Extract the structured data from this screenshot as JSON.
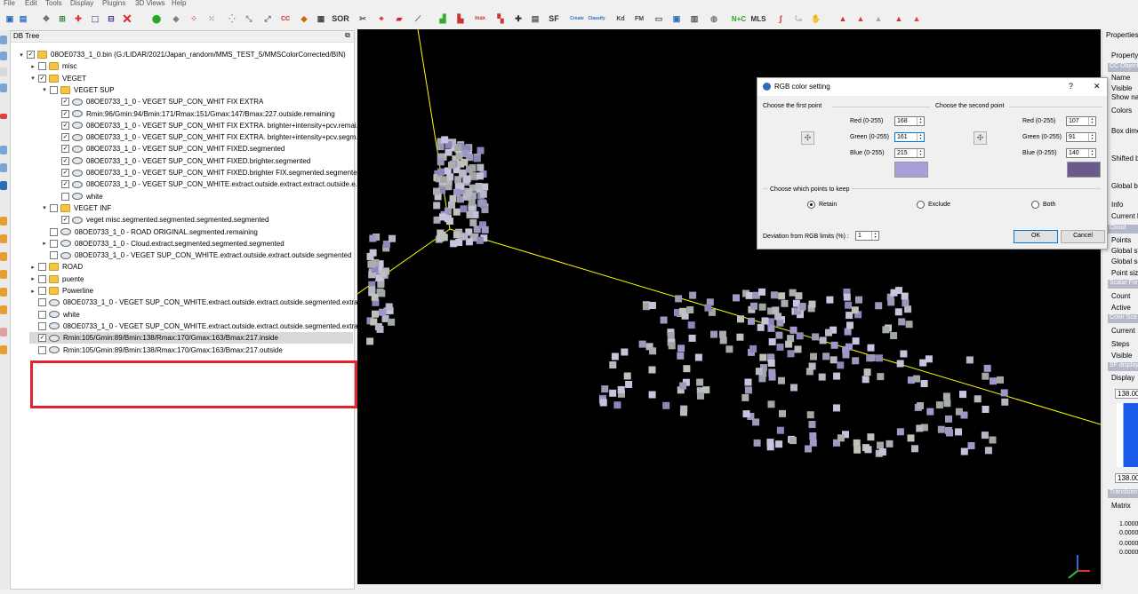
{
  "menu": [
    "File",
    "Edit",
    "Tools",
    "Display",
    "Plugins",
    "3D Views",
    "Help"
  ],
  "toolbar": {
    "sor_label": "SOR",
    "sf_label": "SF",
    "kd_label": "Kd",
    "fm_label": "FM",
    "nc_label": "N+C",
    "mls_label": "MLS",
    "cc_label": "CC",
    "canupo_create": "Create",
    "canupo_classify": "Classify",
    "max_label": "max"
  },
  "dbtree": {
    "title": "DB Tree",
    "items": [
      {
        "label": "08OE0733_1_0.bin (G:/LIDAR/2021/Japan_random/MMS_TEST_5/MMSColorCorrected/BIN)",
        "type": "folder",
        "checked": true,
        "expanded": true
      },
      {
        "label": "misc",
        "type": "folder",
        "checked": false,
        "expanded": false
      },
      {
        "label": "VEGET",
        "type": "folder",
        "checked": true,
        "expanded": true
      },
      {
        "label": "VEGET SUP",
        "type": "folder",
        "checked": false,
        "expanded": true
      },
      {
        "label": "08OE0733_1_0 - VEGET SUP_CON_WHIT FIX EXTRA",
        "type": "cloud",
        "checked": true
      },
      {
        "label": "Rmin:96/Gmin:94/Bmin:171/Rmax:151/Gmax:147/Bmax:227.outside.remaining",
        "type": "cloud",
        "checked": true
      },
      {
        "label": "08OE0733_1_0 - VEGET SUP_CON_WHIT FIX EXTRA. brighter+intensity+pcv.remai...",
        "type": "cloud",
        "checked": true
      },
      {
        "label": "08OE0733_1_0 - VEGET SUP_CON_WHIT FIX EXTRA. brighter+intensity+pcv.segm...",
        "type": "cloud",
        "checked": true
      },
      {
        "label": "08OE0733_1_0 - VEGET SUP_CON_WHIT FIXED.segmented",
        "type": "cloud",
        "checked": true
      },
      {
        "label": "08OE0733_1_0 - VEGET SUP_CON_WHIT FIXED.brighter.segmented",
        "type": "cloud",
        "checked": true
      },
      {
        "label": "08OE0733_1_0 - VEGET SUP_CON_WHIT FIXED.brighter FIX.segmented.segmented",
        "type": "cloud",
        "checked": true
      },
      {
        "label": "08OE0733_1_0 - VEGET SUP_CON_WHITE.extract.outside.extract.extract.outside.e...",
        "type": "cloud",
        "checked": true
      },
      {
        "label": "white",
        "type": "cloud",
        "checked": false
      },
      {
        "label": "VEGET INF",
        "type": "folder",
        "checked": false,
        "expanded": true
      },
      {
        "label": "veget misc.segmented.segmented.segmented.segmented",
        "type": "cloud",
        "checked": true
      },
      {
        "label": "08OE0733_1_0 - ROAD ORIGINAL.segmented.remaining",
        "type": "cloud",
        "checked": false
      },
      {
        "label": "08OE0733_1_0 - Cloud.extract.segmented.segmented.segmented",
        "type": "cloud",
        "checked": false,
        "expanded": false
      },
      {
        "label": "08OE0733_1_0 - VEGET SUP_CON_WHITE.extract.outside.extract.outside.segmented",
        "type": "cloud",
        "checked": false
      },
      {
        "label": "ROAD",
        "type": "folder",
        "checked": false,
        "expanded": false
      },
      {
        "label": "puente",
        "type": "folder",
        "checked": false,
        "expanded": false
      },
      {
        "label": "Powerline",
        "type": "folder",
        "checked": false,
        "expanded": false
      },
      {
        "label": "08OE0733_1_0 - VEGET SUP_CON_WHITE.extract.outside.extract.outside.segmented.extra...",
        "type": "cloud",
        "checked": false
      },
      {
        "label": "white",
        "type": "cloud",
        "checked": false
      },
      {
        "label": "08OE0733_1_0 - VEGET SUP_CON_WHITE.extract.outside.extract.outside.segmented.extra...",
        "type": "cloud",
        "checked": false
      },
      {
        "label": "Rmin:105/Gmin:89/Bmin:138/Rmax:170/Gmax:163/Bmax:217.inside",
        "type": "cloud",
        "checked": true,
        "selected": true
      },
      {
        "label": "Rmin:105/Gmin:89/Bmin:138/Rmax:170/Gmax:163/Bmax:217.outside",
        "type": "cloud",
        "checked": false
      }
    ]
  },
  "properties": {
    "title": "Properties",
    "rows": [
      "Property",
      "CC Object",
      "Name",
      "Visible",
      "Show na",
      "Colors",
      "Box dime",
      "Shifted b",
      "Global bo",
      "Info",
      "Current D",
      "Cloud",
      "Points",
      "Global sh",
      "Global sc",
      "Point size",
      "Scalar Fie",
      "Count",
      "Active",
      "Color Sca",
      "Current",
      "Steps",
      "Visible",
      "SF display",
      "Display",
      "138.000",
      "138.000",
      "Transform",
      "Matrix",
      "1.0000",
      "0.0000",
      "0.0000",
      "0.0000"
    ]
  },
  "dialog": {
    "title": "RGB color setting",
    "help": "?",
    "close": "✕",
    "first_heading": "Choose the first point",
    "second_heading": "Choose the second point",
    "red_label": "Red (0-255)",
    "green_label": "Green (0-255)",
    "blue_label": "Blue (0-255)",
    "first": {
      "red": "168",
      "green": "161",
      "blue": "215",
      "color": "#a8a1d7"
    },
    "second": {
      "red": "107",
      "green": "91",
      "blue": "140",
      "color": "#6b5b8c"
    },
    "keep_heading": "Choose which points to keep",
    "retain": "Retain",
    "exclude": "Exclude",
    "both": "Both",
    "selected_option": "Retain",
    "deviation_label": "Deviation from RGB limits  (%) :",
    "deviation_value": "1",
    "ok": "OK",
    "cancel": "Cancel"
  },
  "colors": {
    "highlight_box": "#e0242b",
    "axis_line": "#ffff00",
    "viewport_bg": "#000000"
  }
}
